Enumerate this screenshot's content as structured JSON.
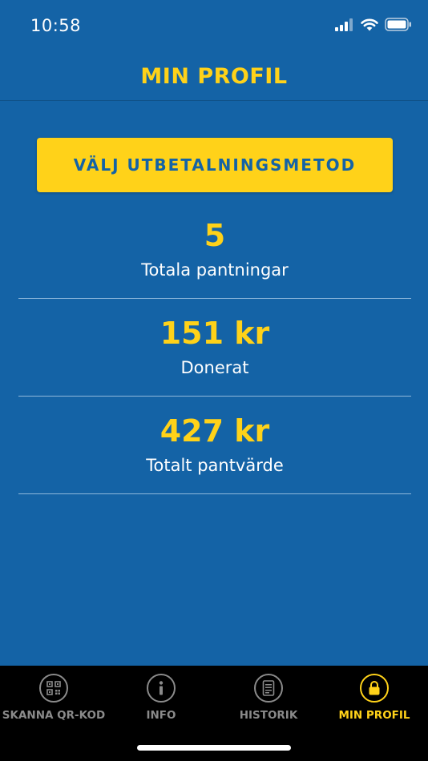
{
  "status_bar": {
    "time": "10:58"
  },
  "header": {
    "title": "MIN PROFIL"
  },
  "payout": {
    "label": "VÄLJ UTBETALNINGSMETOD"
  },
  "stats": [
    {
      "value": "5",
      "label": "Totala pantningar"
    },
    {
      "value": "151 kr",
      "label": "Donerat"
    },
    {
      "value": "427 kr",
      "label": "Totalt pantvärde"
    }
  ],
  "tabs": [
    {
      "label": "SKANNA QR-KOD",
      "icon": "qr-code-icon",
      "active": false
    },
    {
      "label": "INFO",
      "icon": "info-icon",
      "active": false
    },
    {
      "label": "HISTORIK",
      "icon": "receipt-icon",
      "active": false
    },
    {
      "label": "MIN PROFIL",
      "icon": "lock-icon",
      "active": true
    }
  ],
  "colors": {
    "background": "#1463a6",
    "accent": "#ffd219",
    "tab_bar": "#000000",
    "inactive": "#8a8a8a"
  }
}
